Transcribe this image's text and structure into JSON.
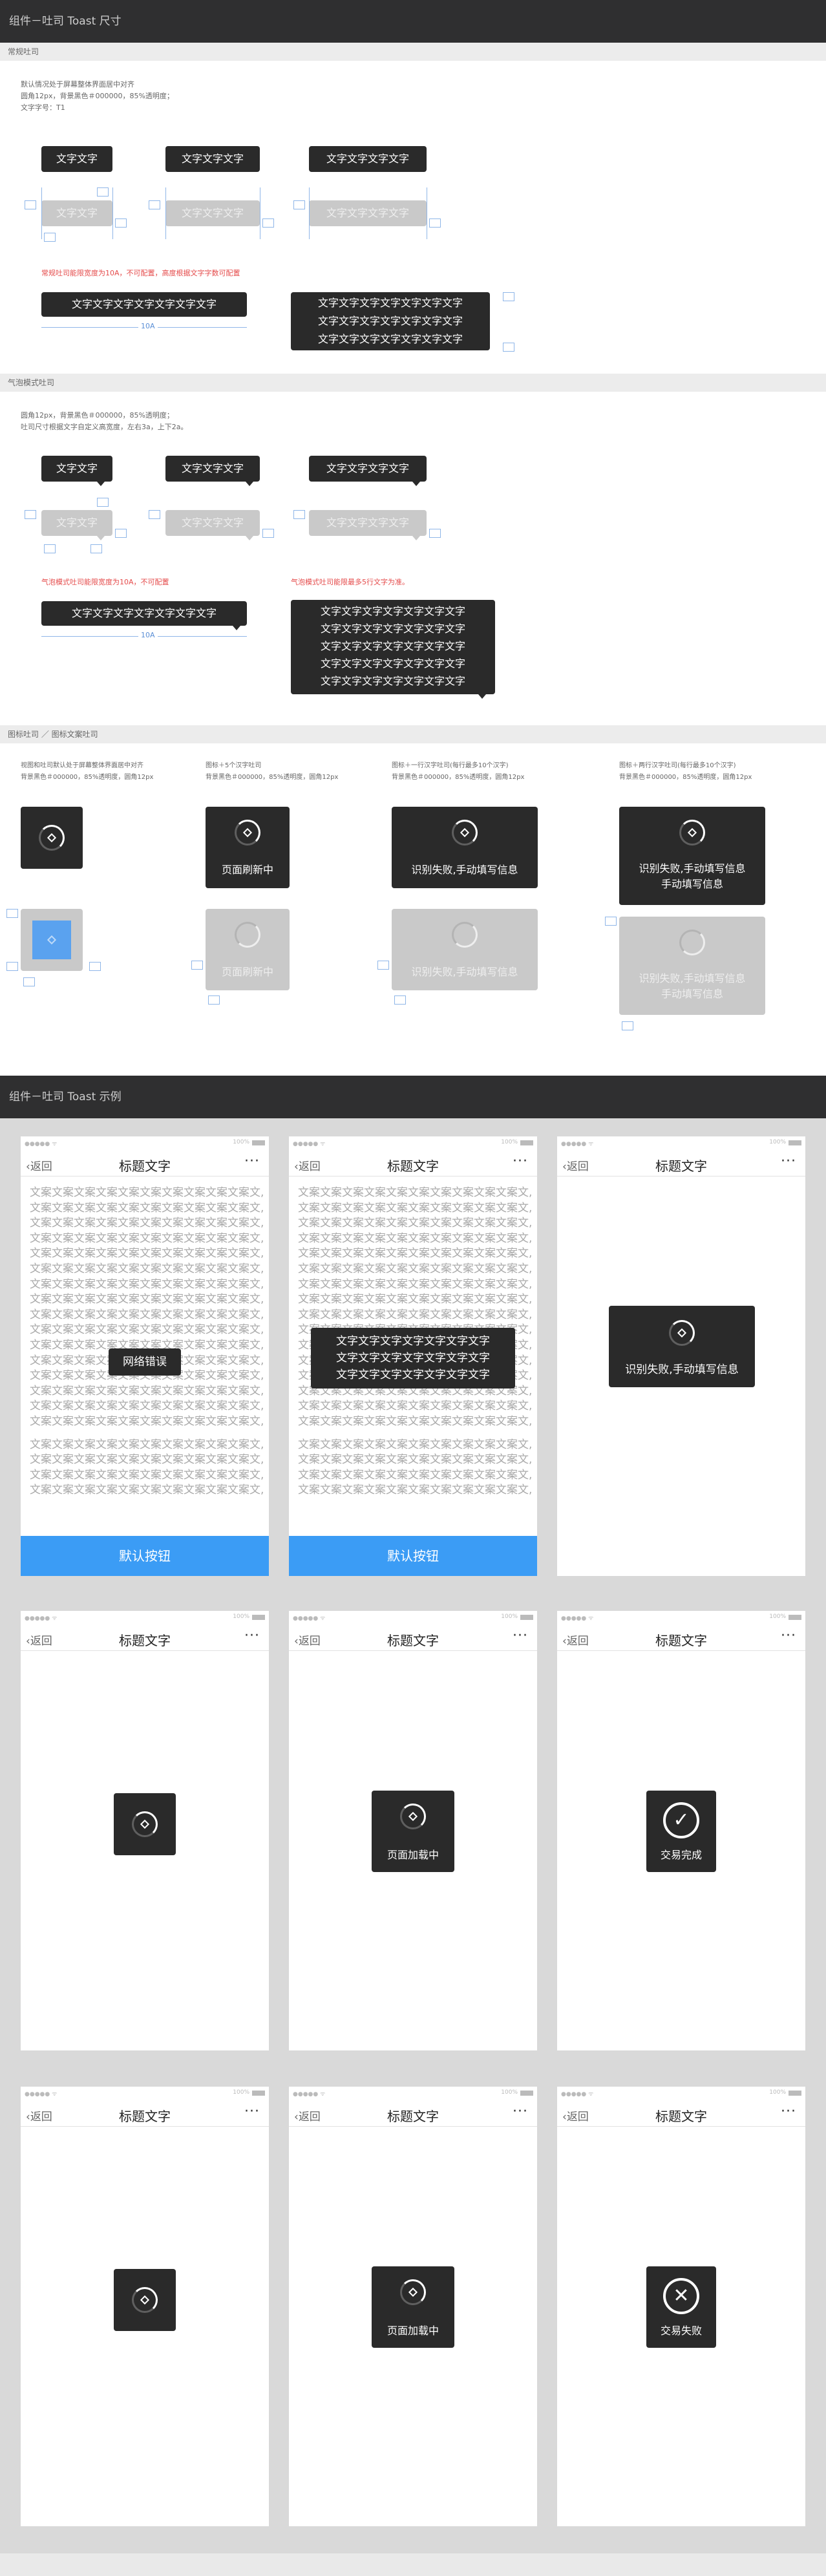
{
  "spec": {
    "title": "组件－吐司 Toast 尺寸",
    "sections": {
      "normal": "常规吐司",
      "bubble": "气泡模式吐司",
      "icon": "图标吐司 ／ 图标文案吐司"
    },
    "normal_note": "默认情况处于屏幕整体界面居中对齐\n圆角12px，背景黑色＃000000，85%透明度；\n文字字号：T1",
    "bubble_note": "圆角12px，背景黑色＃000000，85%透明度；\n吐司尺寸根据文字自定义高宽度，左右3a，上下2a。",
    "toast_short": "文字文字",
    "toast_mid": "文字文字文字",
    "toast_long": "文字文字文字文字",
    "toast_row": "文字文字文字文字文字文字文字",
    "red_note1": "常规吐司能限宽度为10A，不可配置，高度根据文字字数可配置",
    "red_note2": "气泡模式吐司能限宽度为10A，不可配置",
    "red_note3": "气泡模式吐司能限最多5行文字为准。",
    "dim_10a": "10A",
    "icon_notes": [
      "视图和吐司默认处于屏幕整体界面居中对齐\n背景黑色＃000000，85%透明度，圆角12px",
      "图标＋5个汉字吐司\n背景黑色＃000000，85%透明度，圆角12px",
      "图标＋一行汉字吐司(每行最多10个汉字)\n背景黑色＃000000，85%透明度，圆角12px",
      "图标＋两行汉字吐司(每行最多10个汉字)\n背景黑色＃000000，85%透明度，圆角12px"
    ],
    "icon_text1": "页面刷新中",
    "icon_text2": "识别失败,手动填写信息",
    "icon_text3a": "识别失败,手动填写信息",
    "icon_text3b": "手动填写信息"
  },
  "examples": {
    "title": "组件－吐司 Toast 示例",
    "status": "●●●●● ᯤ",
    "battery": "100%",
    "back": "返回",
    "nav_title": "标题文字",
    "more": "···",
    "body_line": "文案文案文案文案文案文案文案文案文案文案文,",
    "button": "默认按钮",
    "toast_network": "网络错误",
    "toast_multi": "文字文字文字文字文字文字文字",
    "toast_fail": "识别失败,手动填写信息",
    "toast_loading": "页面加载中",
    "toast_done": "交易完成",
    "toast_failed": "交易失败"
  }
}
